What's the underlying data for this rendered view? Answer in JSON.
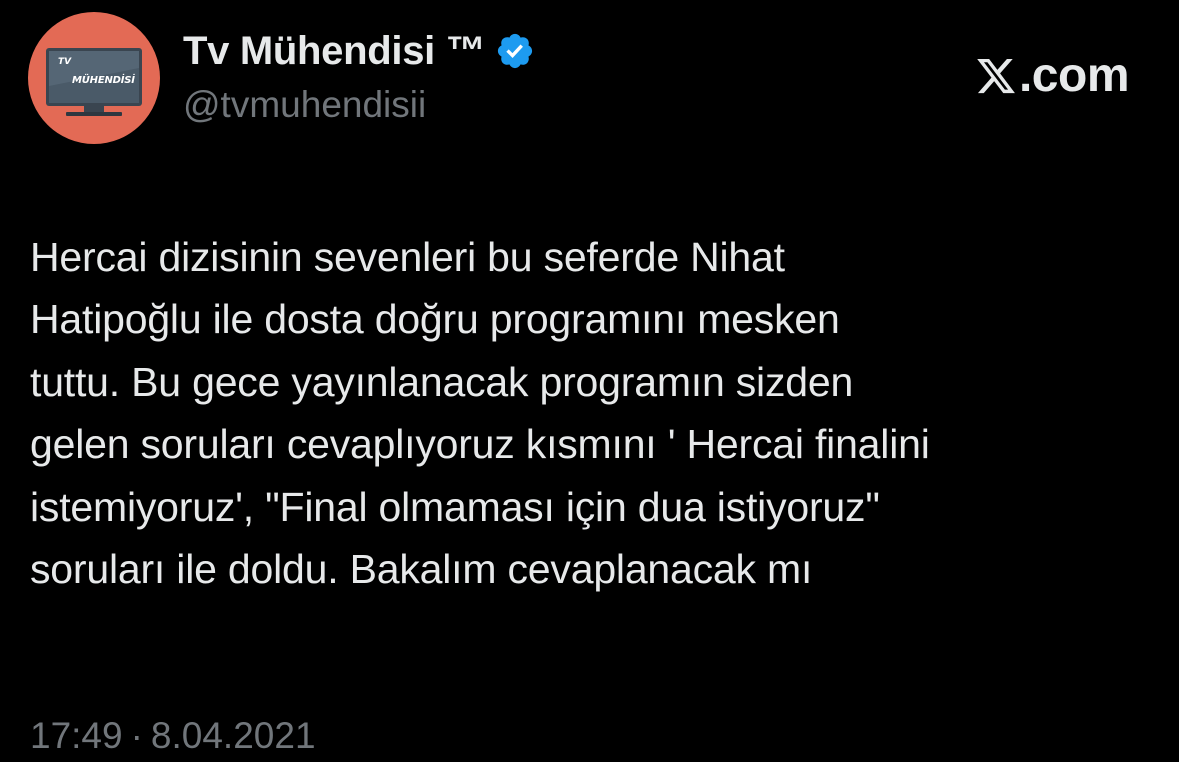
{
  "author": {
    "display_name": "Tv Mühendisi ™",
    "handle": "@tvmuhendisii",
    "verified": true,
    "verified_icon": "verified-badge-icon",
    "avatar": {
      "line1": "TV",
      "line2": "MÜHENDİSİ",
      "background_color": "#e36a55",
      "screen_color": "#4a5a68"
    }
  },
  "brand": {
    "logo_icon": "x-logo-icon",
    "text": ".com"
  },
  "tweet": {
    "lines": [
      "Hercai dizisinin sevenleri bu seferde Nihat",
      "Hatipoğlu ile dosta doğru programını mesken",
      "tuttu. Bu gece yayınlanacak programın sizden",
      "gelen soruları cevaplıyoruz kısmını ' Hercai finalini",
      "istemiyoruz', \"Final olmaması için dua istiyoruz\"",
      "soruları ile doldu. Bakalım cevaplanacak mı"
    ]
  },
  "meta": {
    "time": "17:49",
    "separator": "·",
    "date": "8.04.2021"
  },
  "colors": {
    "background": "#000000",
    "primary_text": "#e7e9ea",
    "secondary_text": "#71767b",
    "verified_blue": "#1d9bf0"
  }
}
